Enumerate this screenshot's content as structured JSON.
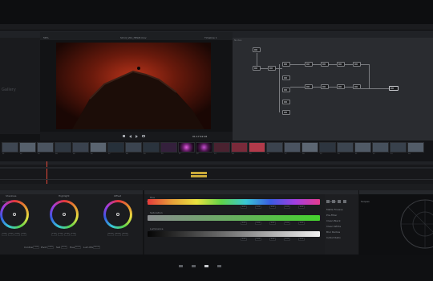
{
  "menu": {
    "items": [
      "DaVinci",
      "Resolve",
      "File",
      "Edit",
      "Trim",
      "Timeline",
      "Clip",
      "Mark",
      "View",
      "Playback",
      "Workspace",
      "Help"
    ]
  },
  "project_title": "Spidery_DRB_DVResolve_v023",
  "viewer": {
    "clip_name": "SC14_V01_HELM.mov",
    "zoom": "56%",
    "timecode": "01:17:42:16",
    "frame_label": "Timeline 1"
  },
  "left_panel": {
    "label": "Gallery"
  },
  "node_graph": {
    "title": "Nodes"
  },
  "clip_strip": {
    "clip_numbers": [
      "01",
      "02",
      "03",
      "04",
      "05",
      "06",
      "07",
      "08",
      "09",
      "10",
      "11",
      "12",
      "13",
      "14",
      "15",
      "16",
      "17",
      "18",
      "19",
      "20",
      "21",
      "22",
      "23",
      "24"
    ]
  },
  "panels": {
    "wheels_title": "Color Wheels",
    "bars_title": "Curves",
    "qualifier_title": "Qualifier",
    "scope_title": "Scopes"
  },
  "wheels": [
    {
      "name": "Shadows",
      "values": [
        "0.00",
        "0.00",
        "0.00",
        "0.00"
      ]
    },
    {
      "name": "Highlight",
      "values": [
        "1.00",
        "1.00",
        "1.00",
        "1.00"
      ]
    },
    {
      "name": "Offset",
      "values": [
        "25.00",
        "25.00",
        "25.00"
      ]
    }
  ],
  "wheel_footer": [
    "Contrast",
    "1.000",
    "Pivot",
    "0.435",
    "Sat",
    "50.00",
    "Hue",
    "50.00",
    "Lum Mix",
    "100.00"
  ],
  "bars": [
    {
      "name": "Hue",
      "values": [
        "0.00",
        "0.00",
        "0.00",
        "0.00",
        "0.00"
      ]
    },
    {
      "name": "Saturation",
      "values": [
        "0.00",
        "0.00",
        "0.00",
        "0.00",
        "0.00"
      ]
    },
    {
      "name": "Luminance",
      "values": [
        "0.00",
        "0.00",
        "0.00",
        "0.00",
        "0.00"
      ]
    }
  ],
  "qualifier": {
    "labels": [
      "Matte Finesse",
      "Pre-Filter",
      "Clean Black",
      "Clean White",
      "Blur Radius",
      "In/Out Ratio"
    ]
  },
  "colors": {
    "accent": "#e34a3a",
    "panel": "#1b1c1f",
    "node_bg": "#2a2c30"
  }
}
